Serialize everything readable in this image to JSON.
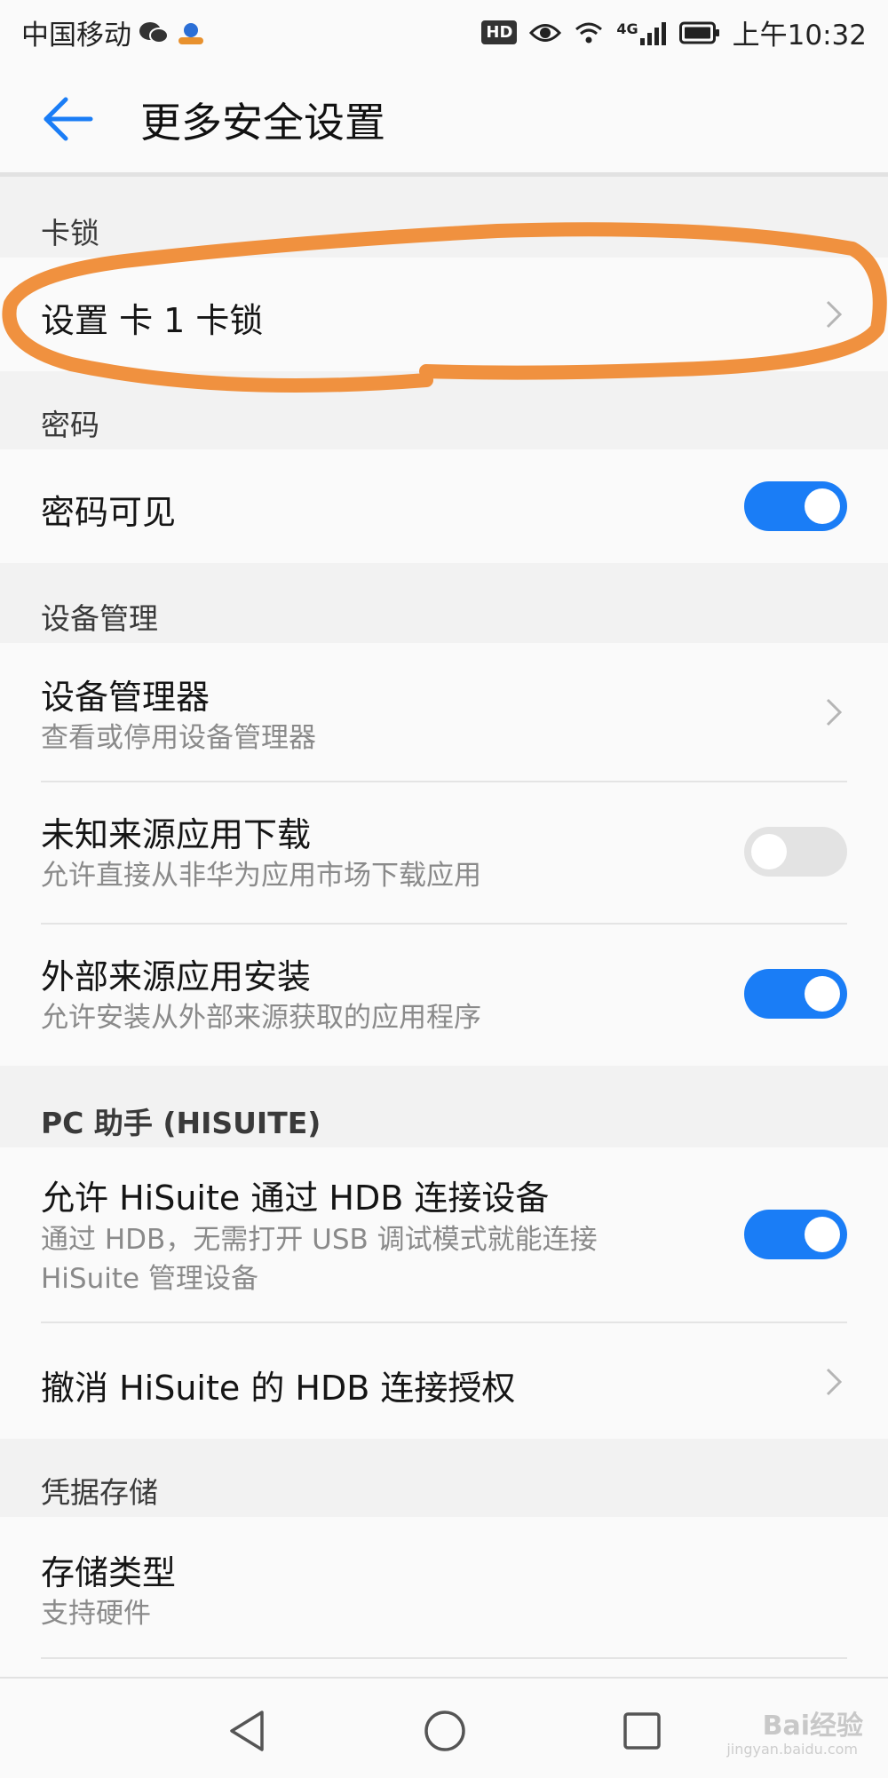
{
  "status_bar": {
    "carrier": "中国移动",
    "network": "4G",
    "time": "上午10:32",
    "hd": "HD"
  },
  "app_bar": {
    "title": "更多安全设置"
  },
  "sections": {
    "card_lock": {
      "header": "卡锁",
      "item_title": "设置 卡 1 卡锁"
    },
    "password": {
      "header": "密码",
      "item_title": "密码可见",
      "toggle_on": true
    },
    "device_management": {
      "header": "设备管理",
      "admins_title": "设备管理器",
      "admins_subtitle": "查看或停用设备管理器",
      "unknown_title": "未知来源应用下载",
      "unknown_subtitle": "允许直接从非华为应用市场下载应用",
      "unknown_toggle_on": false,
      "external_title": "外部来源应用安装",
      "external_subtitle": "允许安装从外部来源获取的应用程序",
      "external_toggle_on": true
    },
    "pc_assistant": {
      "header": "PC 助手 (HISUITE)",
      "hdb_title": "允许 HiSuite 通过 HDB 连接设备",
      "hdb_subtitle_line1": "通过 HDB，无需打开 USB 调试模式就能连接",
      "hdb_subtitle_line2": "HiSuite 管理设备",
      "hdb_toggle_on": true,
      "revoke_title": "撤消 HiSuite 的 HDB 连接授权"
    },
    "credential_storage": {
      "header": "凭据存储",
      "storage_title": "存储类型",
      "storage_subtitle": "支持硬件"
    }
  },
  "watermark": {
    "text": "Bai经验",
    "sub": "jingyan.baidu.com"
  },
  "colors": {
    "accent": "#1a7df6",
    "highlight_annotation": "#f0913f"
  }
}
